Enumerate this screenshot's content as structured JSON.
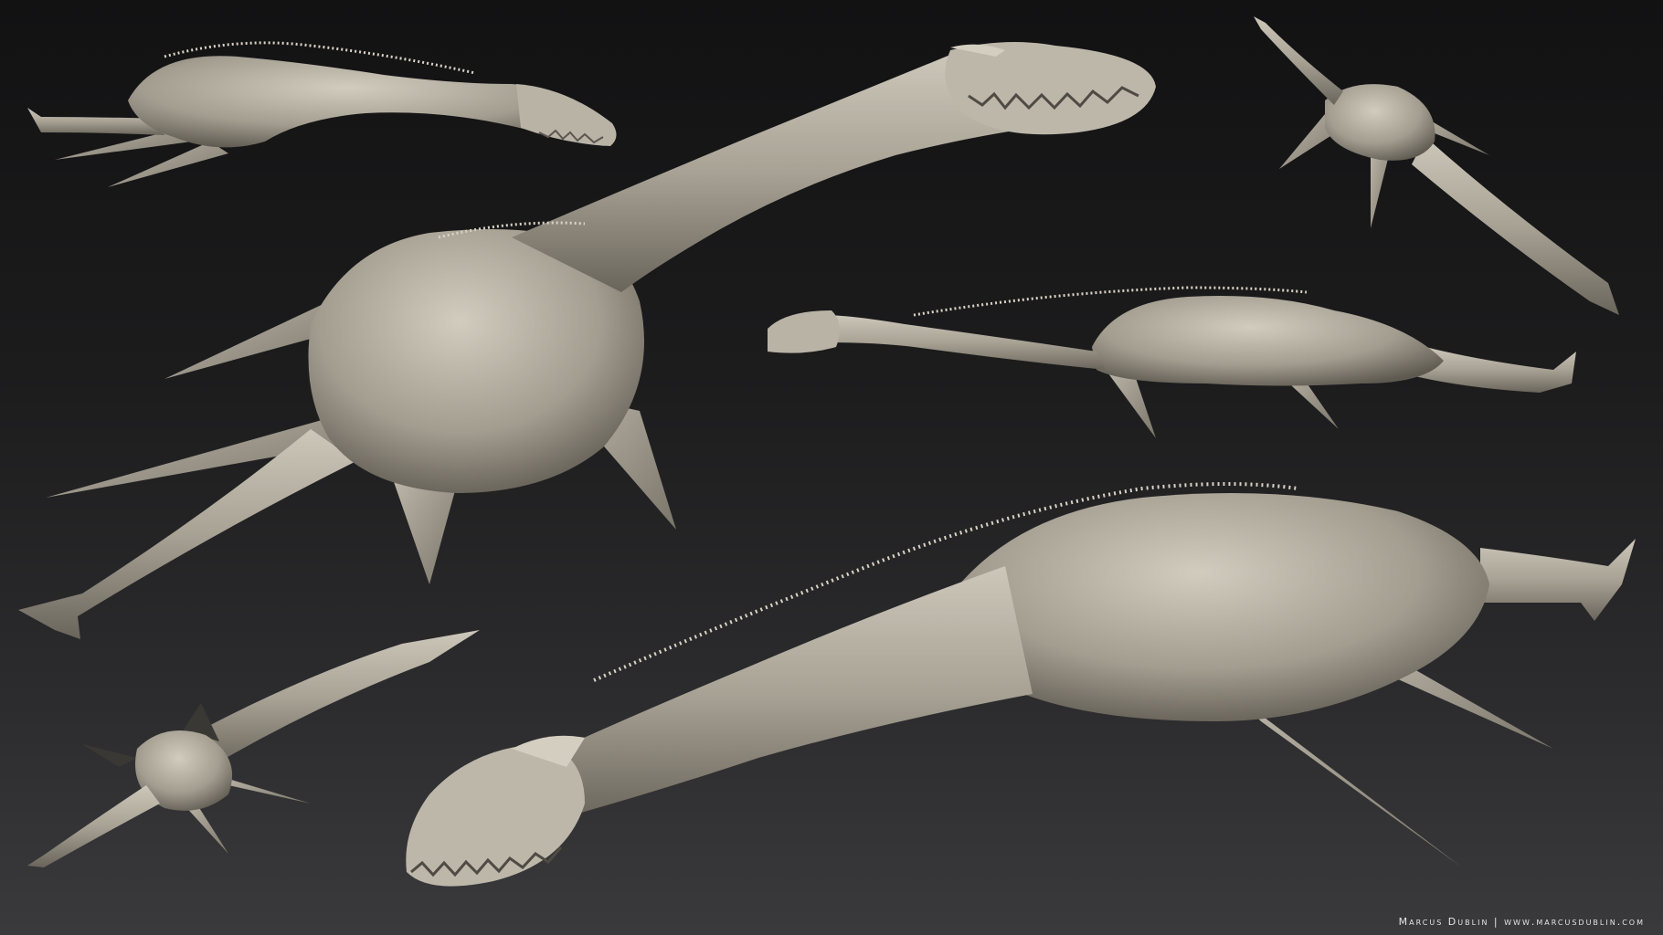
{
  "scene": {
    "subject_count": 6,
    "colors": {
      "background_top": "#121213",
      "background_bottom": "#3a3a3c",
      "clay_light": "#c9c3b6",
      "clay_mid": "#a59f92",
      "clay_dark": "#6d685e"
    }
  },
  "credit": {
    "text": "Marcus Dublin | www.marcusdublin.com"
  }
}
